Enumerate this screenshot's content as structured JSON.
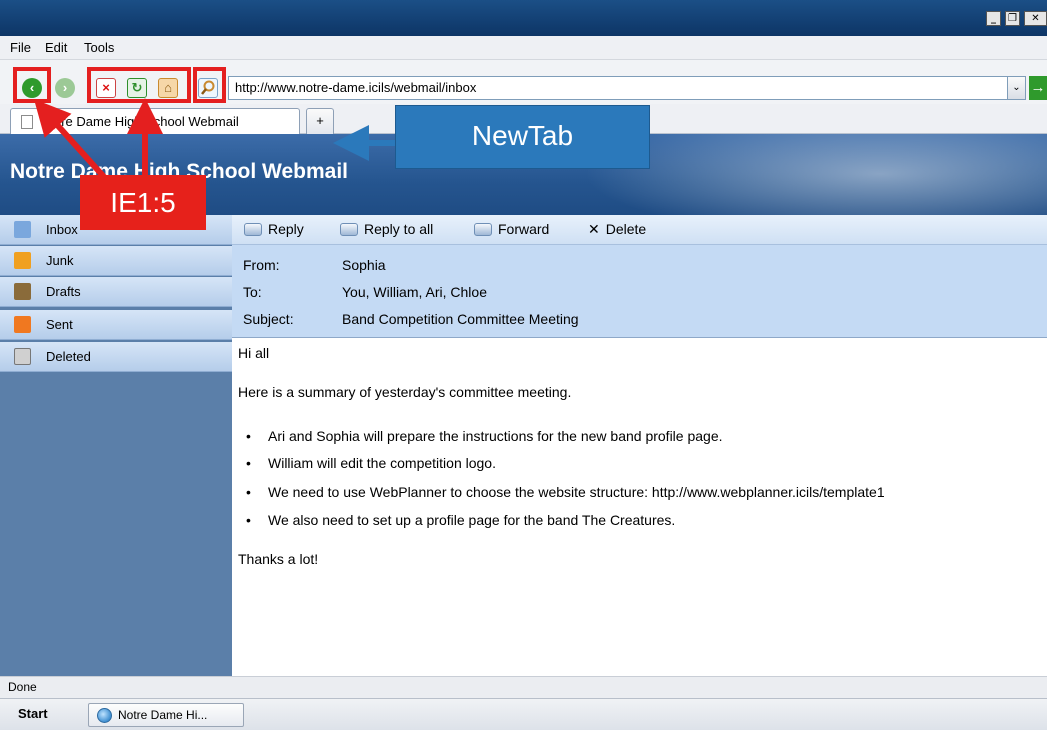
{
  "window": {
    "buttons": {
      "minimize": "_",
      "restore": "❐",
      "close": "✕"
    }
  },
  "menu": {
    "items": [
      "File",
      "Edit",
      "Tools"
    ]
  },
  "toolbar": {
    "address": "http://www.notre-dame.icils/webmail/inbox",
    "dropdown_glyph": "⌄",
    "go_glyph": "→",
    "icons": [
      "back-icon",
      "forward-icon",
      "stop-icon",
      "refresh-icon",
      "home-icon",
      "search-icon"
    ]
  },
  "tabs": {
    "active_label": "Notre Dame High School Webmail",
    "new_tab_label": "+"
  },
  "site": {
    "title": "Notre Dame High School Webmail"
  },
  "sidebar": {
    "items": [
      {
        "label": "Inbox",
        "icon": "inbox-icon",
        "color": "#7aa7dd"
      },
      {
        "label": "Junk",
        "icon": "junk-icon",
        "color": "#f0a020"
      },
      {
        "label": "Drafts",
        "icon": "drafts-icon",
        "color": "#8a6b3a"
      },
      {
        "label": "Sent",
        "icon": "sent-icon",
        "color": "#f07820"
      },
      {
        "label": "Deleted",
        "icon": "trash-icon",
        "color": "#d0d0d0"
      }
    ]
  },
  "actions": {
    "reply": "Reply",
    "reply_all": "Reply to all",
    "forward": "Forward",
    "delete": "Delete",
    "delete_glyph": "✕"
  },
  "email": {
    "labels": {
      "from": "From:",
      "to": "To:",
      "subject": "Subject:"
    },
    "from": "Sophia",
    "to": "You, William, Ari, Chloe",
    "subject": "Band Competition Committee Meeting",
    "greeting": "Hi all",
    "intro": "Here is a summary of yesterday's committee meeting.",
    "bullets": [
      "Ari and Sophia will prepare the instructions for the new band profile page.",
      "William will edit the competition logo.",
      "We need to use WebPlanner to choose the website structure: http://www.webplanner.icils/template1",
      "We also need to set up a profile page for the band The Creatures."
    ],
    "closing": "Thanks a lot!"
  },
  "status": {
    "text": "Done"
  },
  "taskbar": {
    "start": "Start",
    "task_label": "Notre Dame Hi..."
  },
  "annotations": {
    "newtab": "NewTab",
    "ie": "IE1:5",
    "red": "#e41f1f",
    "blue": "#2b79bb"
  }
}
